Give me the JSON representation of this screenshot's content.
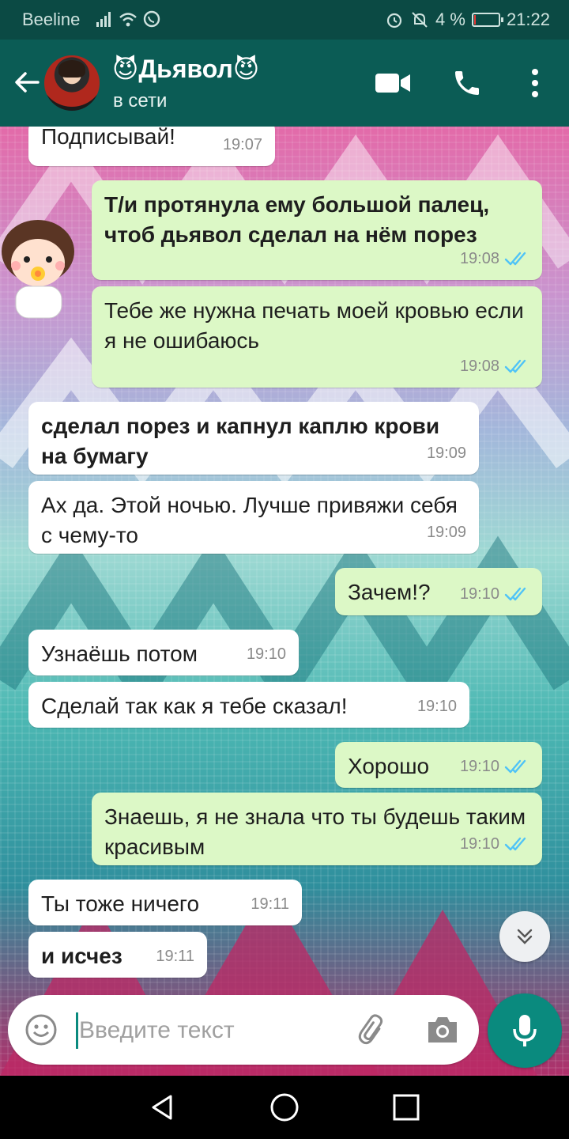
{
  "status_bar": {
    "carrier": "Beeline",
    "battery": "4 %",
    "battery_level": 0.04,
    "time": "21:22"
  },
  "header": {
    "contact_name": "😈Дьявол😈",
    "status": "в сети"
  },
  "messages": [
    {
      "dir": "in",
      "text": "Подписывай!",
      "time": "19:07",
      "bold": false
    },
    {
      "dir": "out",
      "text": "Т/и протянула ему большой палец, чтоб дьявол сделал на нём порез",
      "time": "19:08",
      "bold": true
    },
    {
      "dir": "out",
      "text": "Тебе же нужна печать моей кровью если я не ошибаюсь",
      "time": "19:08",
      "bold": false
    },
    {
      "dir": "in",
      "text": "сделал порез и капнул каплю крови на бумагу",
      "time": "19:09",
      "bold": true
    },
    {
      "dir": "in",
      "text": "Ах да. Этой ночью. Лучше привяжи себя с чему-то",
      "time": "19:09",
      "bold": false
    },
    {
      "dir": "out",
      "text": "Зачем!?",
      "time": "19:10",
      "bold": false
    },
    {
      "dir": "in",
      "text": "Узнаёшь потом",
      "time": "19:10",
      "bold": false
    },
    {
      "dir": "in",
      "text": "Сделай так как я тебе сказал!",
      "time": "19:10",
      "bold": false
    },
    {
      "dir": "out",
      "text": "Хорошо",
      "time": "19:10",
      "bold": false
    },
    {
      "dir": "out",
      "text": "Знаешь, я не знала что ты будешь таким красивым",
      "time": "19:10",
      "bold": false
    },
    {
      "dir": "in",
      "text": "Ты тоже ничего",
      "time": "19:11",
      "bold": false
    },
    {
      "dir": "in",
      "text": "и исчез",
      "time": "19:11",
      "bold": true
    }
  ],
  "input": {
    "placeholder": "Введите текст"
  },
  "colors": {
    "header": "#0b5c55",
    "outgoing_bubble": "#dcf8c6",
    "incoming_bubble": "#ffffff",
    "read_tick": "#4fc3f7",
    "mic_button": "#0a8a7e"
  }
}
